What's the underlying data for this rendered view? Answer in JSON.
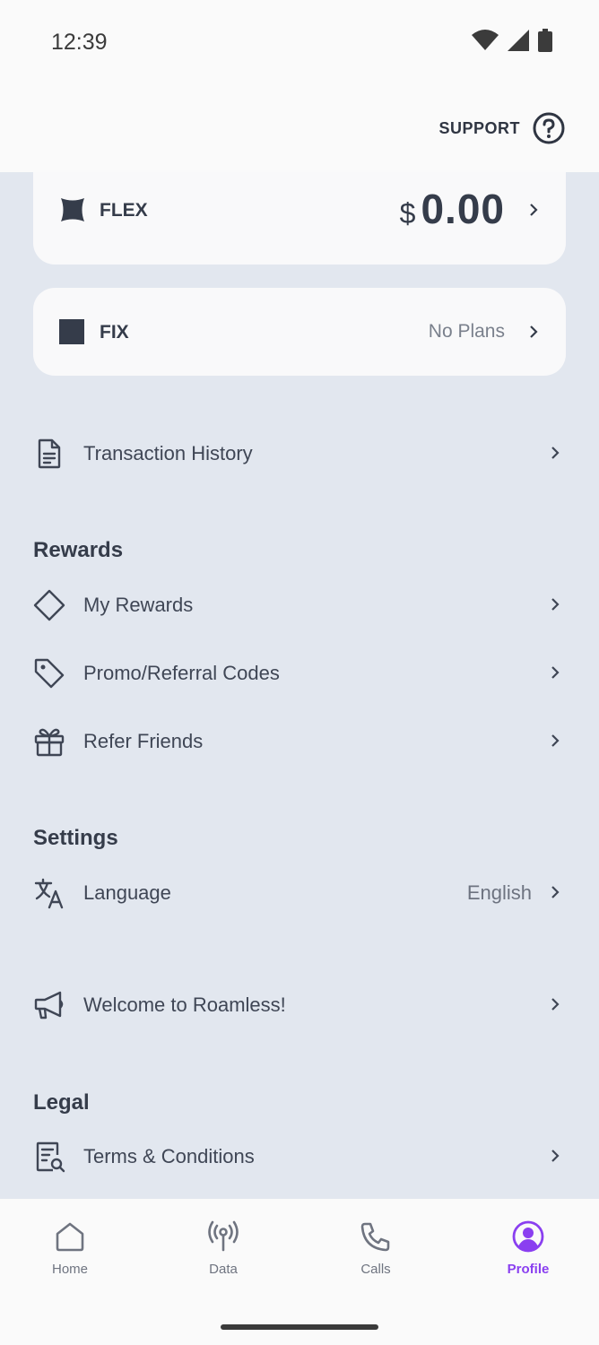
{
  "status_bar": {
    "time": "12:39"
  },
  "header": {
    "support_label": "SUPPORT"
  },
  "cards": {
    "flex": {
      "name": "FLEX",
      "currency": "$",
      "amount": "0.00"
    },
    "fix": {
      "name": "FIX",
      "value": "No Plans"
    }
  },
  "transactions": {
    "label": "Transaction History"
  },
  "rewards": {
    "title": "Rewards",
    "items": [
      {
        "label": "My Rewards"
      },
      {
        "label": "Promo/Referral Codes"
      },
      {
        "label": "Refer Friends"
      }
    ]
  },
  "settings": {
    "title": "Settings",
    "language": {
      "label": "Language",
      "value": "English"
    }
  },
  "announcement": {
    "label": "Welcome to Roamless!"
  },
  "legal": {
    "title": "Legal",
    "items": [
      {
        "label": "Terms & Conditions"
      }
    ]
  },
  "nav": {
    "items": [
      {
        "label": "Home",
        "icon": "home-icon"
      },
      {
        "label": "Data",
        "icon": "antenna-icon"
      },
      {
        "label": "Calls",
        "icon": "phone-icon"
      },
      {
        "label": "Profile",
        "icon": "profile-icon"
      }
    ],
    "active_color": "#8a3ff0"
  }
}
